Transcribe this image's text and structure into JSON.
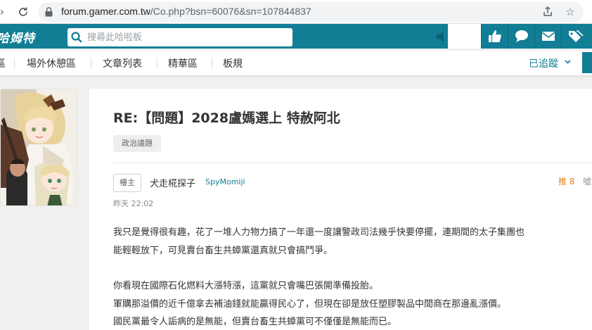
{
  "browser": {
    "url_host": "forum.gamer.com.tw",
    "url_path": "/Co.php?bsn=60076&sn=107844837"
  },
  "site": {
    "logo_text": "巴哈姆特",
    "search_placeholder": "搜尋此哈啦板",
    "accent_color": "#117e96"
  },
  "subnav": {
    "items": [
      "區",
      "場外休憩區",
      "文章列表",
      "精華區",
      "板規"
    ],
    "follow_label": "已追蹤"
  },
  "post": {
    "title": "RE:【問題】2028盧媽選上 特赦阿北",
    "tag": "政治議題",
    "op_badge": "樓主",
    "author_name": "犬走椛探子",
    "author_id": "SpyMomiji",
    "push_label": "推 8",
    "boo_label": "噓",
    "time": "昨天 22:02",
    "body": [
      "我只是覺得很有趣，花了一堆人力物力搞了一年還一度讓警政司法幾乎快要停擺，連期間的太子集團也",
      "能輕輕放下，可見賣台畜生共蟑黨還真就只會搞鬥爭。",
      "",
      "你看現在國際石化燃料大漲特漲，這黨就只會嘴巴張開準備投胎。",
      "軍購那溢價的近千億拿去補油錢就能贏得民心了，但現在卻是放任塑膠製品中間商在那邊亂漲價。",
      "國民黨最令人詬病的是無能，但賣台畜生共蟑黨可不僅僅是無能而已。"
    ]
  }
}
